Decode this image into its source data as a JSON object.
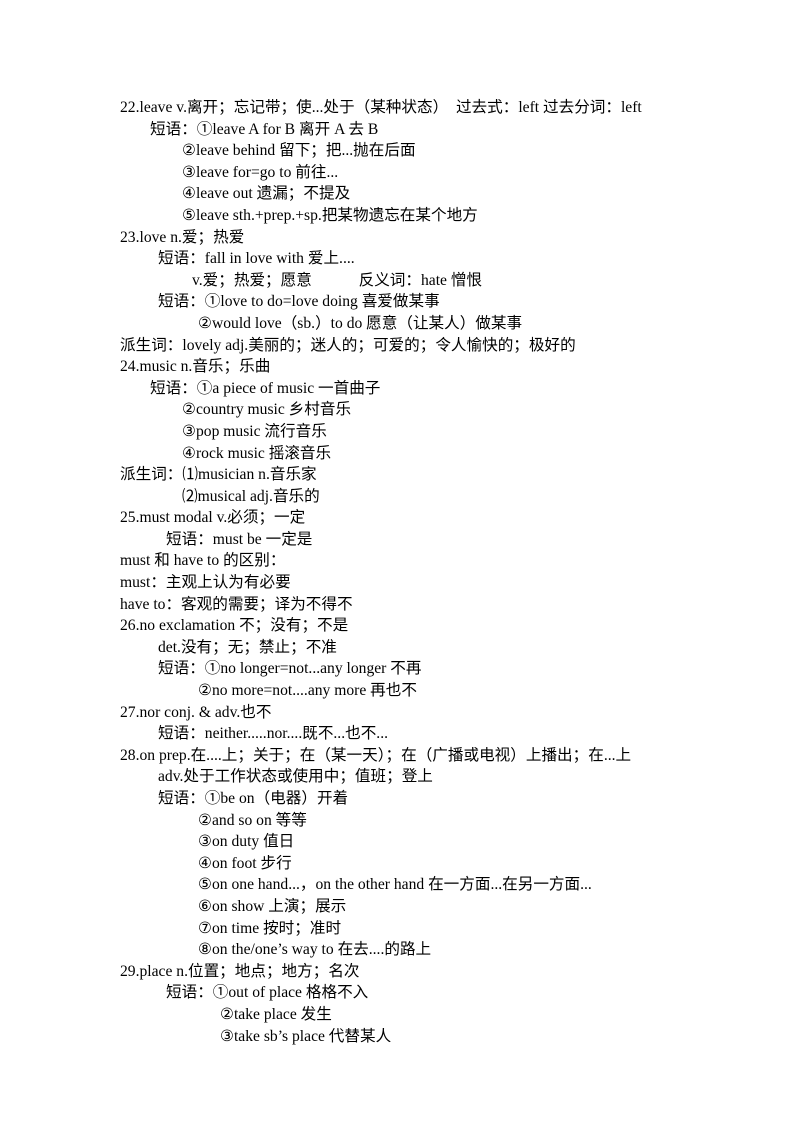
{
  "document": {
    "background_color": "#ffffff",
    "text_color": "#000000",
    "entries": [
      {
        "number": "22",
        "headword": "leave",
        "lines": [
          {
            "id": "l1",
            "indent": 0,
            "text": "22.leave v.离开；忘记带；使...处于（某种状态）　过去式：left 过去分词：left"
          },
          {
            "id": "l2",
            "indent": 1,
            "text": "短语：①leave A for B 离开 A 去 B"
          },
          {
            "id": "l3",
            "indent": 4,
            "text": "②leave behind 留下；把...抛在后面"
          },
          {
            "id": "l4",
            "indent": 4,
            "text": "③leave for=go to 前往..."
          },
          {
            "id": "l5",
            "indent": 4,
            "text": "④leave out 遗漏；不提及"
          },
          {
            "id": "l6",
            "indent": 4,
            "text": "⑤leave sth.+prep.+sp.把某物遗忘在某个地方"
          }
        ]
      },
      {
        "number": "23",
        "headword": "love",
        "lines": [
          {
            "id": "l7",
            "indent": 0,
            "text": "23.love n.爱；热爱"
          },
          {
            "id": "l8",
            "indent": 2,
            "text": "短语：fall in love with 爱上...."
          },
          {
            "id": "l9",
            "indent": 5,
            "text": "v.爱；热爱；愿意　　　反义词：hate 憎恨"
          },
          {
            "id": "l10",
            "indent": 2,
            "text": "短语：①love to do=love doing 喜爱做某事"
          },
          {
            "id": "l11",
            "indent": 6,
            "text": "②would love（sb.）to do 愿意（让某人）做某事"
          },
          {
            "id": "l12",
            "indent": 0,
            "text": "派生词：lovely adj.美丽的；迷人的；可爱的；令人愉快的；极好的"
          }
        ]
      },
      {
        "number": "24",
        "headword": "music",
        "lines": [
          {
            "id": "l13",
            "indent": 0,
            "text": "24.music n.音乐；乐曲"
          },
          {
            "id": "l14",
            "indent": 1,
            "text": "短语：①a piece of music 一首曲子"
          },
          {
            "id": "l15",
            "indent": 4,
            "text": "②country music 乡村音乐"
          },
          {
            "id": "l16",
            "indent": 4,
            "text": "③pop music 流行音乐"
          },
          {
            "id": "l17",
            "indent": 4,
            "text": "④rock music 摇滚音乐"
          },
          {
            "id": "l18",
            "indent": 0,
            "text": "派生词：⑴musician n.音乐家"
          },
          {
            "id": "l19",
            "indent": 4,
            "text": "⑵musical adj.音乐的"
          }
        ]
      },
      {
        "number": "25",
        "headword": "must",
        "lines": [
          {
            "id": "l20",
            "indent": 0,
            "text": "25.must modal v.必须；一定"
          },
          {
            "id": "l21",
            "indent": 3,
            "text": "短语：must be 一定是"
          },
          {
            "id": "l22",
            "indent": 0,
            "text": "must 和 have to 的区别："
          },
          {
            "id": "l23",
            "indent": 0,
            "text": "must：主观上认为有必要"
          },
          {
            "id": "l24",
            "indent": 0,
            "text": "have to：客观的需要；译为不得不"
          }
        ]
      },
      {
        "number": "26",
        "headword": "no",
        "lines": [
          {
            "id": "l25",
            "indent": 0,
            "text": "26.no exclamation 不；没有；不是"
          },
          {
            "id": "l26",
            "indent": 2,
            "text": "det.没有；无；禁止；不准"
          },
          {
            "id": "l27",
            "indent": 2,
            "text": "短语：①no longer=not...any longer 不再"
          },
          {
            "id": "l28",
            "indent": 6,
            "text": "②no more=not....any more 再也不"
          }
        ]
      },
      {
        "number": "27",
        "headword": "nor",
        "lines": [
          {
            "id": "l29",
            "indent": 0,
            "text": "27.nor conj. & adv.也不"
          },
          {
            "id": "l30",
            "indent": 2,
            "text": "短语：neither.....nor....既不...也不..."
          }
        ]
      },
      {
        "number": "28",
        "headword": "on",
        "lines": [
          {
            "id": "l31",
            "indent": 0,
            "text": "28.on prep.在....上；关于；在（某一天）；在（广播或电视）上播出；在...上"
          },
          {
            "id": "l32",
            "indent": 2,
            "text": "adv.处于工作状态或使用中；值班；登上"
          },
          {
            "id": "l33",
            "indent": 2,
            "text": "短语：①be on（电器）开着"
          },
          {
            "id": "l34",
            "indent": 6,
            "text": "②and so on 等等"
          },
          {
            "id": "l35",
            "indent": 6,
            "text": "③on duty 值日"
          },
          {
            "id": "l36",
            "indent": 6,
            "text": "④on foot 步行"
          },
          {
            "id": "l37",
            "indent": 6,
            "text": "⑤on one hand...，on the other hand 在一方面...在另一方面..."
          },
          {
            "id": "l38",
            "indent": 6,
            "text": "⑥on show 上演；展示"
          },
          {
            "id": "l39",
            "indent": 6,
            "text": "⑦on time 按时；准时"
          },
          {
            "id": "l40",
            "indent": 6,
            "text": "⑧on the/one’s way to 在去....的路上"
          }
        ]
      },
      {
        "number": "29",
        "headword": "place",
        "lines": [
          {
            "id": "l41",
            "indent": 0,
            "text": "29.place n.位置；地点；地方；名次"
          },
          {
            "id": "l42",
            "indent": 3,
            "text": "短语：①out of place 格格不入"
          },
          {
            "id": "l43",
            "indent": 7,
            "text": "②take place 发生"
          },
          {
            "id": "l44",
            "indent": 7,
            "text": "③take sb’s place 代替某人"
          }
        ]
      }
    ]
  }
}
